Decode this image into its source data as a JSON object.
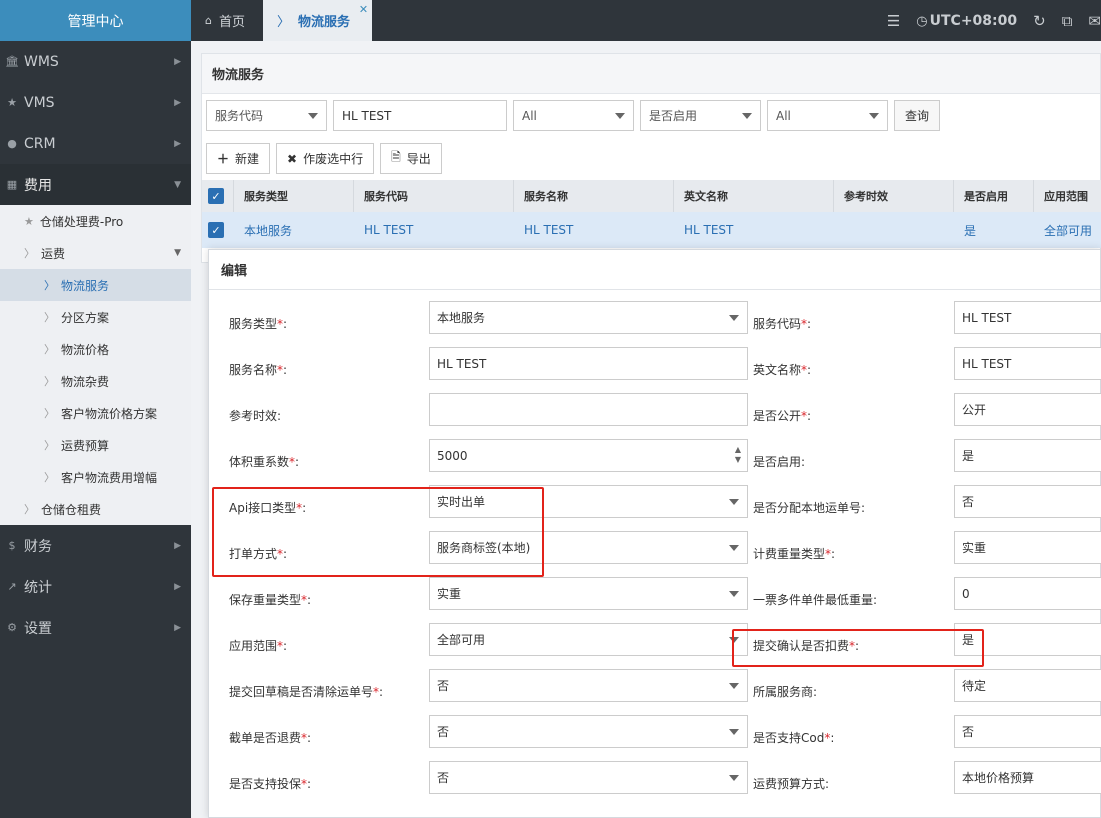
{
  "sidebar": {
    "title": "管理中心",
    "items": [
      {
        "label": "WMS",
        "icon": "bank-icon"
      },
      {
        "label": "VMS",
        "icon": "star-icon"
      },
      {
        "label": "CRM",
        "icon": "user-circle-icon"
      },
      {
        "label": "费用",
        "icon": "grid-icon"
      }
    ],
    "sub": {
      "warehouse_fee": "仓储处理费-Pro",
      "freight": "运费",
      "freight_children": [
        "物流服务",
        "分区方案",
        "物流价格",
        "物流杂费",
        "客户物流价格方案",
        "运费预算",
        "客户物流费用增幅"
      ],
      "storage_rent": "仓储仓租费"
    },
    "bottom_items": [
      {
        "label": "财务",
        "icon": "dollar-icon"
      },
      {
        "label": "统计",
        "icon": "chart-icon"
      },
      {
        "label": "设置",
        "icon": "gear-icon"
      }
    ]
  },
  "topbar": {
    "home": "首页",
    "active_tab": "物流服务",
    "timezone": "UTC+08:00"
  },
  "panel": {
    "title": "物流服务",
    "filters": {
      "field_select": "服务代码",
      "field_value": "HL TEST",
      "select2": "All",
      "enabled_select": "是否启用",
      "select4": "All",
      "query": "查询"
    },
    "actions": {
      "new": "新建",
      "void": "作废选中行",
      "export": "导出"
    },
    "table": {
      "headers": [
        "服务类型",
        "服务代码",
        "服务名称",
        "英文名称",
        "参考时效",
        "是否启用",
        "应用范围"
      ],
      "row": [
        "本地服务",
        "HL TEST",
        "HL TEST",
        "HL TEST",
        "",
        "是",
        "全部可用"
      ]
    }
  },
  "modal": {
    "title": "编辑",
    "rows": [
      {
        "l1": "服务类型",
        "r1": true,
        "v1": "本地服务",
        "t1": "select",
        "l2": "服务代码",
        "r2": true,
        "v2": "HL TEST"
      },
      {
        "l1": "服务名称",
        "r1": true,
        "v1": "HL TEST",
        "t1": "input",
        "l2": "英文名称",
        "r2": true,
        "v2": "HL TEST"
      },
      {
        "l1": "参考时效",
        "r1": false,
        "v1": "",
        "t1": "input",
        "l2": "是否公开",
        "r2": true,
        "v2": "公开"
      },
      {
        "l1": "体积重系数",
        "r1": true,
        "v1": "5000",
        "t1": "number",
        "l2": "是否启用",
        "r2": false,
        "v2": "是"
      },
      {
        "l1": "Api接口类型",
        "r1": true,
        "v1": "实时出单",
        "t1": "select",
        "l2": "是否分配本地运单号",
        "r2": false,
        "v2": "否"
      },
      {
        "l1": "打单方式",
        "r1": true,
        "v1": "服务商标签(本地)",
        "t1": "select",
        "l2": "计费重量类型",
        "r2": true,
        "v2": "实重"
      },
      {
        "l1": "保存重量类型",
        "r1": true,
        "v1": "实重",
        "t1": "select",
        "l2": "一票多件单件最低重量",
        "r2": false,
        "v2": "0"
      },
      {
        "l1": "应用范围",
        "r1": true,
        "v1": "全部可用",
        "t1": "select",
        "l2": "提交确认是否扣费",
        "r2": true,
        "v2": "是"
      },
      {
        "l1": "提交回草稿是否清除运单号",
        "r1": true,
        "v1": "否",
        "t1": "select",
        "l2": "所属服务商",
        "r2": false,
        "v2": "待定"
      },
      {
        "l1": "截单是否退费",
        "r1": true,
        "v1": "否",
        "t1": "select",
        "l2": "是否支持Cod",
        "r2": true,
        "v2": "否"
      },
      {
        "l1": "是否支持投保",
        "r1": true,
        "v1": "否",
        "t1": "select",
        "l2": "运费预算方式",
        "r2": false,
        "v2": "本地价格预算"
      }
    ]
  },
  "colors": {
    "accent": "#3c8dbc",
    "link": "#2a6fb3",
    "highlight_box": "#e2231a",
    "sidebar_bg": "#2f353b"
  }
}
